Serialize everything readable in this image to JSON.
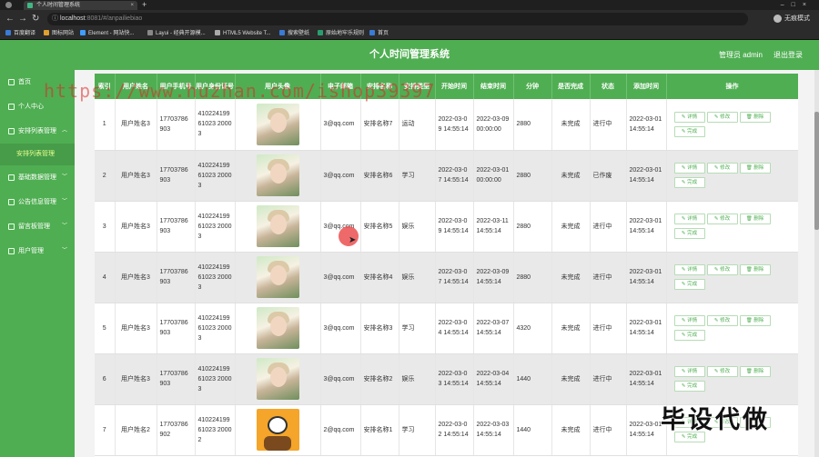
{
  "browser": {
    "tab_title": "个人时间管理系统",
    "url_host": "localhost",
    "url_rest": ":8081/#/anpailiebiao",
    "profile": "无痕模式",
    "bookmarks": [
      "百度翻译",
      "图标网站",
      "Element - 网站快...",
      "Layui - 经典开源模...",
      "HTML5 Website T...",
      "搜索壁纸",
      "原始地牢乐规则",
      "首页"
    ]
  },
  "header": {
    "title": "个人时间管理系统",
    "admin": "管理员 admin",
    "logout": "退出登录"
  },
  "sidebar": {
    "items": [
      {
        "label": "首页"
      },
      {
        "label": "个人中心"
      },
      {
        "label": "安排列表管理"
      },
      {
        "label": "基础数据管理"
      },
      {
        "label": "公告信息管理"
      },
      {
        "label": "留言板管理"
      },
      {
        "label": "用户管理"
      }
    ],
    "sub_active": "安排列表管理"
  },
  "table": {
    "columns": [
      "索引",
      "用户姓名",
      "用户手机号",
      "用户身份证号",
      "用户头像",
      "电子邮箱",
      "安排名称",
      "安排类型",
      "开始时间",
      "结束时间",
      "分钟",
      "是否完成",
      "状态",
      "添加时间",
      "操作"
    ],
    "actions": {
      "detail": "详情",
      "edit": "修改",
      "delete": "删除",
      "complete": "完成"
    },
    "rows": [
      {
        "idx": "1",
        "name": "用户姓名3",
        "phone": "17703786903",
        "idcard": "41022419961023 20003",
        "email": "3@qq.com",
        "plan": "安排名称7",
        "type": "运动",
        "start": "2022-03-09 14:55:14",
        "end": "2022-03-09 00:00:00",
        "minutes": "2880",
        "done": "未完成",
        "status": "进行中",
        "added": "2022-03-01 14:55:14"
      },
      {
        "idx": "2",
        "name": "用户姓名3",
        "phone": "17703786903",
        "idcard": "41022419961023 20003",
        "email": "3@qq.com",
        "plan": "安排名称6",
        "type": "学习",
        "start": "2022-03-07 14:55:14",
        "end": "2022-03-01 00:00:00",
        "minutes": "2880",
        "done": "未完成",
        "status": "已作废",
        "added": "2022-03-01 14:55:14"
      },
      {
        "idx": "3",
        "name": "用户姓名3",
        "phone": "17703786903",
        "idcard": "41022419961023 20003",
        "email": "3@qq.com",
        "plan": "安排名称5",
        "type": "娱乐",
        "start": "2022-03-09 14:55:14",
        "end": "2022-03-11 14:55:14",
        "minutes": "2880",
        "done": "未完成",
        "status": "进行中",
        "added": "2022-03-01 14:55:14"
      },
      {
        "idx": "4",
        "name": "用户姓名3",
        "phone": "17703786903",
        "idcard": "41022419961023 20003",
        "email": "3@qq.com",
        "plan": "安排名称4",
        "type": "娱乐",
        "start": "2022-03-07 14:55:14",
        "end": "2022-03-09 14:55:14",
        "minutes": "2880",
        "done": "未完成",
        "status": "进行中",
        "added": "2022-03-01 14:55:14"
      },
      {
        "idx": "5",
        "name": "用户姓名3",
        "phone": "17703786903",
        "idcard": "41022419961023 20003",
        "email": "3@qq.com",
        "plan": "安排名称3",
        "type": "学习",
        "start": "2022-03-04 14:55:14",
        "end": "2022-03-07 14:55:14",
        "minutes": "4320",
        "done": "未完成",
        "status": "进行中",
        "added": "2022-03-01 14:55:14"
      },
      {
        "idx": "6",
        "name": "用户姓名3",
        "phone": "17703786903",
        "idcard": "41022419961023 20003",
        "email": "3@qq.com",
        "plan": "安排名称2",
        "type": "娱乐",
        "start": "2022-03-03 14:55:14",
        "end": "2022-03-04 14:55:14",
        "minutes": "1440",
        "done": "未完成",
        "status": "进行中",
        "added": "2022-03-01 14:55:14"
      },
      {
        "idx": "7",
        "name": "用户姓名2",
        "phone": "17703786902",
        "idcard": "41022419961023 20002",
        "email": "2@qq.com",
        "plan": "安排名称1",
        "type": "学习",
        "start": "2022-03-02 14:55:14",
        "end": "2022-03-03 14:55:14",
        "minutes": "1440",
        "done": "未完成",
        "status": "进行中",
        "added": "2022-03-01 14:55:14"
      }
    ]
  },
  "overlays": {
    "watermark": "https://www.huzhan.com/ishop39397",
    "stamp": "毕设代做"
  },
  "colors": {
    "brand": "#4fae52",
    "alt_row": "#e9e9e9"
  }
}
